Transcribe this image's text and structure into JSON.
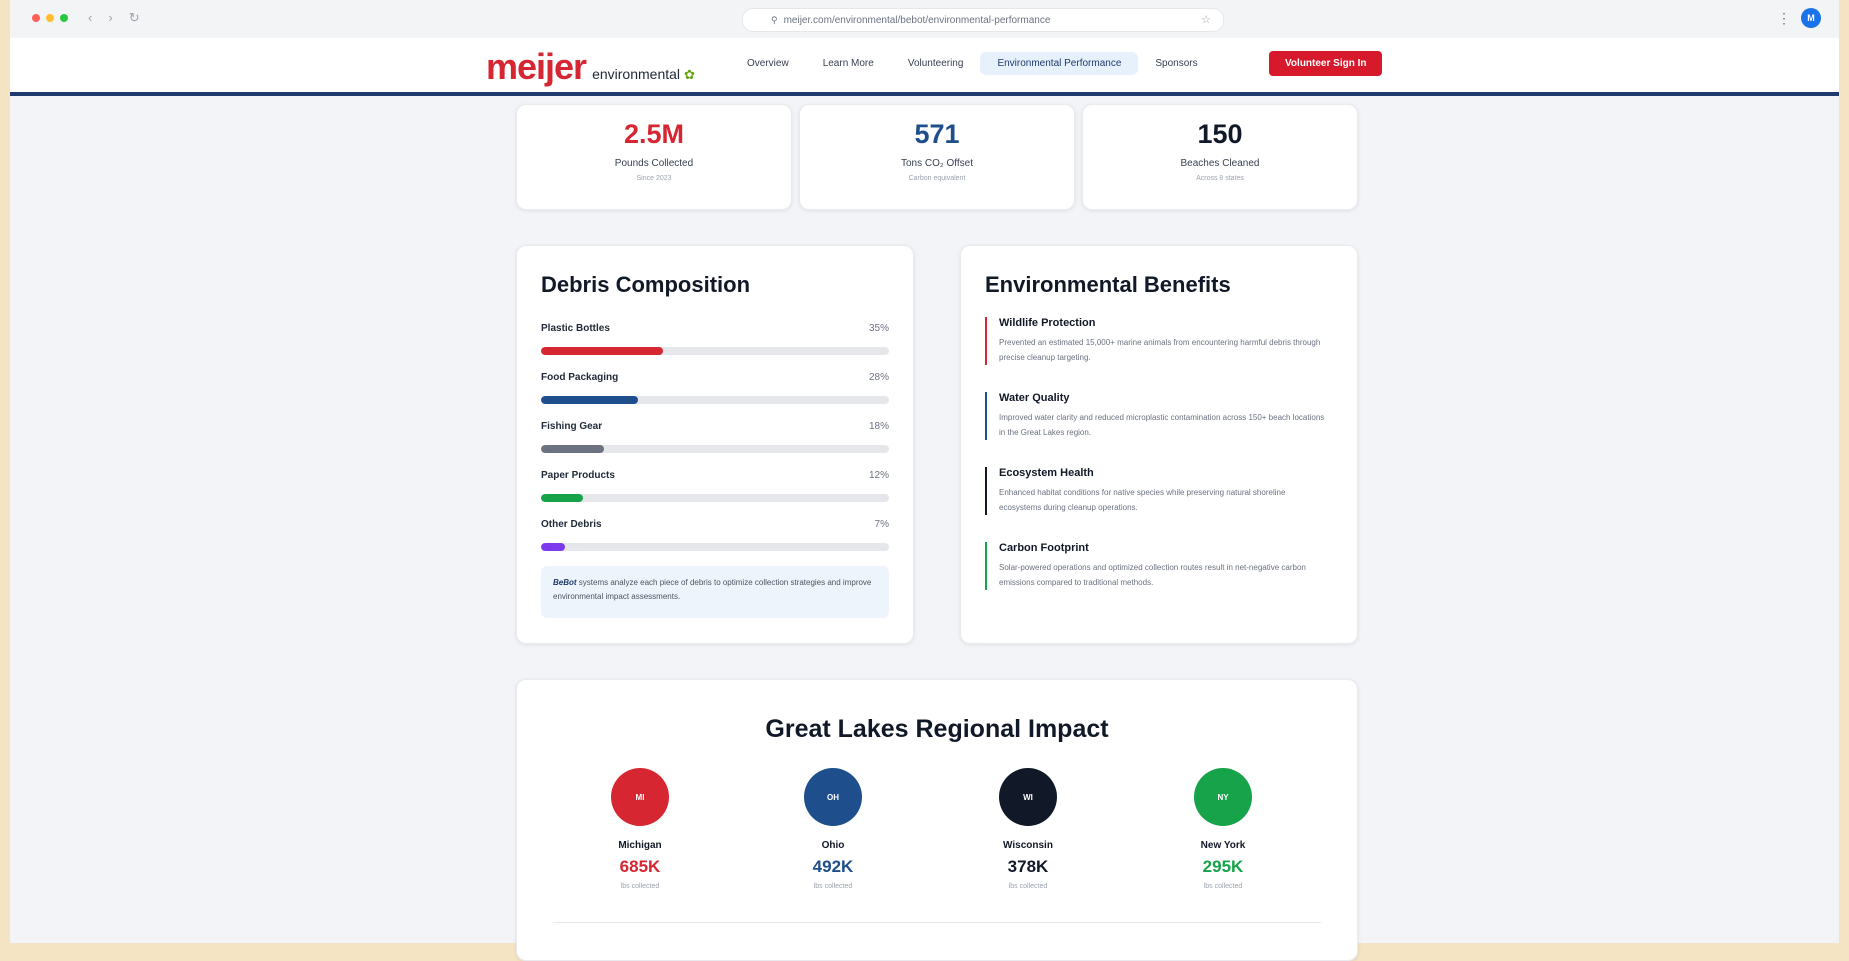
{
  "browser": {
    "url": "meijer.com/environmental/bebot/environmental-performance",
    "dot_colors": [
      "#ff5f57",
      "#febc2e",
      "#28c840"
    ],
    "profile_initial": "M"
  },
  "header": {
    "brand": "meijer",
    "subbrand": "environmental",
    "nav": [
      "Overview",
      "Learn More",
      "Volunteering",
      "Environmental Performance",
      "Sponsors"
    ],
    "active_nav": "Environmental Performance",
    "signin_label": "Volunteer Sign In"
  },
  "stats": [
    {
      "value": "2.5M",
      "label": "Pounds Collected",
      "sub": "Since 2023",
      "color": "#d62631"
    },
    {
      "value": "571",
      "label": "Tons CO₂ Offset",
      "sub": "Carbon equivalent",
      "color": "#1e4f8c"
    },
    {
      "value": "150",
      "label": "Beaches Cleaned",
      "sub": "Across 8 states",
      "color": "#111827"
    }
  ],
  "debris": {
    "title": "Debris Composition",
    "items": [
      {
        "name": "Plastic Bottles",
        "pct_label": "35%",
        "pct": 35,
        "color": "#d62631"
      },
      {
        "name": "Food Packaging",
        "pct_label": "28%",
        "pct": 28,
        "color": "#1e4f8c"
      },
      {
        "name": "Fishing Gear",
        "pct_label": "18%",
        "pct": 18,
        "color": "#6b7280"
      },
      {
        "name": "Paper Products",
        "pct_label": "12%",
        "pct": 12,
        "color": "#16a34a"
      },
      {
        "name": "Other Debris",
        "pct_label": "7%",
        "pct": 7,
        "color": "#7c3aed"
      }
    ],
    "note_brand": "BeBot",
    "note_text": " systems analyze each piece of debris to optimize collection strategies and improve environmental impact assessments."
  },
  "benefits": {
    "title": "Environmental Benefits",
    "items": [
      {
        "title": "Wildlife Protection",
        "desc": "Prevented an estimated 15,000+ marine animals from encountering harmful debris through precise cleanup targeting.",
        "color": "#d62631"
      },
      {
        "title": "Water Quality",
        "desc": "Improved water clarity and reduced microplastic contamination across 150+ beach locations in the Great Lakes region.",
        "color": "#1e4f8c"
      },
      {
        "title": "Ecosystem Health",
        "desc": "Enhanced habitat conditions for native species while preserving natural shoreline ecosystems during cleanup operations.",
        "color": "#111827"
      },
      {
        "title": "Carbon Footprint",
        "desc": "Solar-powered operations and optimized collection routes result in net-negative carbon emissions compared to traditional methods.",
        "color": "#16a34a"
      }
    ]
  },
  "regional": {
    "title": "Great Lakes Regional Impact",
    "regions": [
      {
        "abbr": "MI",
        "name": "Michigan",
        "value": "685K",
        "sub": "lbs collected",
        "color": "#d62631"
      },
      {
        "abbr": "OH",
        "name": "Ohio",
        "value": "492K",
        "sub": "lbs collected",
        "color": "#1e4f8c"
      },
      {
        "abbr": "WI",
        "name": "Wisconsin",
        "value": "378K",
        "sub": "lbs collected",
        "color": "#111827"
      },
      {
        "abbr": "NY",
        "name": "New York",
        "value": "295K",
        "sub": "lbs collected",
        "color": "#16a34a"
      }
    ]
  }
}
